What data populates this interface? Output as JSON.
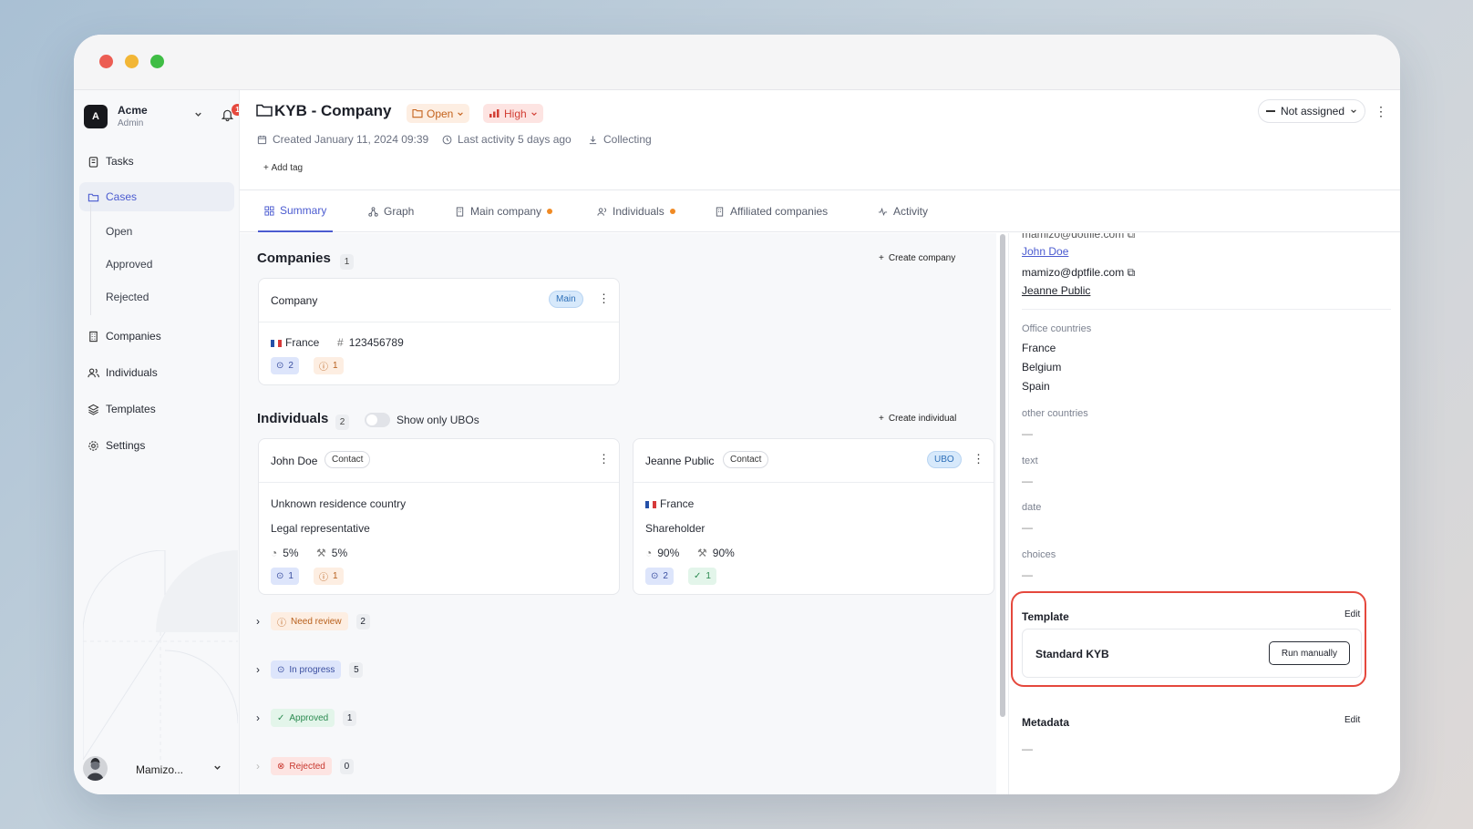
{
  "window": {
    "dots": [
      "#ec5d53",
      "#f2b636",
      "#3fbd45"
    ]
  },
  "sidebar": {
    "org_initial": "A",
    "org_name": "Acme",
    "org_role": "Admin",
    "notifications": "1",
    "items": [
      {
        "label": "Tasks",
        "icon": "clipboard-icon"
      },
      {
        "label": "Cases",
        "icon": "folder-icon"
      },
      {
        "label": "Companies",
        "icon": "building-icon"
      },
      {
        "label": "Individuals",
        "icon": "users-icon"
      },
      {
        "label": "Templates",
        "icon": "layers-icon"
      },
      {
        "label": "Settings",
        "icon": "gear-icon"
      }
    ],
    "sub_items": [
      "Open",
      "Approved",
      "Rejected"
    ],
    "user_name": "Mamizo..."
  },
  "header": {
    "title": "KYB - Company",
    "status": "Open",
    "risk": "High",
    "created": "Created January 11, 2024 09:39",
    "last_activity": "Last activity 5 days ago",
    "stage": "Collecting",
    "add_tag": "Add tag",
    "assignee": "Not assigned"
  },
  "tabs": [
    {
      "label": "Summary"
    },
    {
      "label": "Graph"
    },
    {
      "label": "Main company"
    },
    {
      "label": "Individuals"
    },
    {
      "label": "Affiliated companies"
    },
    {
      "label": "Activity"
    }
  ],
  "companies": {
    "title": "Companies",
    "count": "1",
    "create": "Create company",
    "card": {
      "name": "Company",
      "badge": "Main",
      "country": "France",
      "reg_number": "123456789",
      "in_progress": "2",
      "review": "1"
    }
  },
  "individuals": {
    "title": "Individuals",
    "count": "2",
    "toggle_label": "Show only UBOs",
    "create": "Create individual",
    "people": [
      {
        "name": "John Doe",
        "tag": "Contact",
        "country": "Unknown residence country",
        "role": "Legal representative",
        "shares": "5%",
        "votes": "5%",
        "in_progress": "1",
        "review": "1"
      },
      {
        "name": "Jeanne Public",
        "tag": "Contact",
        "badge": "UBO",
        "country": "France",
        "role": "Shareholder",
        "shares": "90%",
        "votes": "90%",
        "in_progress": "2",
        "approved": "1"
      }
    ]
  },
  "statuses": [
    {
      "label": "Need review",
      "count": "2"
    },
    {
      "label": "In progress",
      "count": "5"
    },
    {
      "label": "Approved",
      "count": "1"
    },
    {
      "label": "Rejected",
      "count": "0"
    }
  ],
  "details": {
    "email_top": "mamizo@dotfile.com",
    "link1": "John Doe",
    "email2": "mamizo@dptfile.com",
    "link2": "Jeanne Public",
    "office_label": "Office countries",
    "office": [
      "France",
      "Belgium",
      "Spain"
    ],
    "other_label": "other countries",
    "other_value": "—",
    "text_label": "text",
    "text_value": "—",
    "date_label": "date",
    "date_value": "—",
    "choices_label": "choices",
    "choices_value": "—"
  },
  "template": {
    "title": "Template",
    "edit": "Edit",
    "name": "Standard KYB",
    "run": "Run manually"
  },
  "metadata": {
    "title": "Metadata",
    "edit": "Edit",
    "value": "—"
  }
}
